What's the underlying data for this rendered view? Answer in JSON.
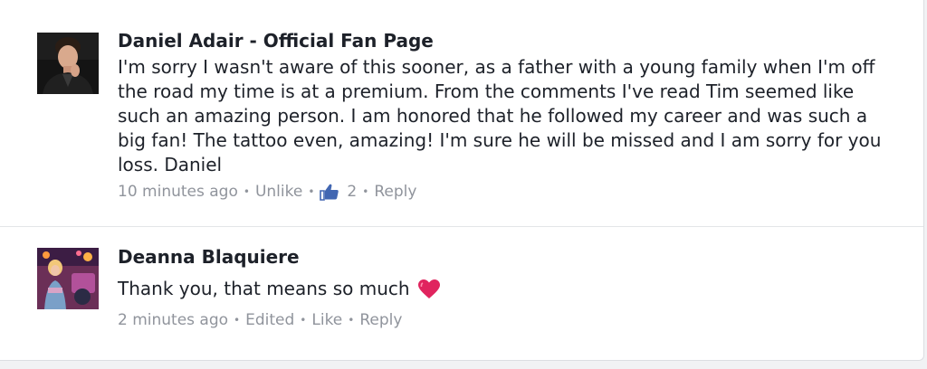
{
  "comments": [
    {
      "author": "Daniel Adair - Official Fan Page",
      "text": "I'm sorry I wasn't aware of this sooner, as a father with a young family when I'm off the road my time is at a premium. From the comments I've read Tim seemed like such an amazing person. I am honored that he followed my career and was such a big fan! The tattoo even, amazing! I'm sure he will be missed and I am sorry for you loss. Daniel",
      "timestamp": "10 minutes ago",
      "like_action": "Unlike",
      "like_count": "2",
      "reply_action": "Reply",
      "like_icon": "thumbs-up-icon"
    },
    {
      "author": "Deanna Blaquiere",
      "text": "Thank you, that means so much",
      "emoji": "heart-icon",
      "timestamp": "2 minutes ago",
      "edited_label": "Edited",
      "like_action": "Like",
      "reply_action": "Reply"
    }
  ],
  "colors": {
    "text": "#1d2129",
    "meta": "#90949c",
    "like_blue": "#4267b2",
    "heart": "#e0245e"
  }
}
